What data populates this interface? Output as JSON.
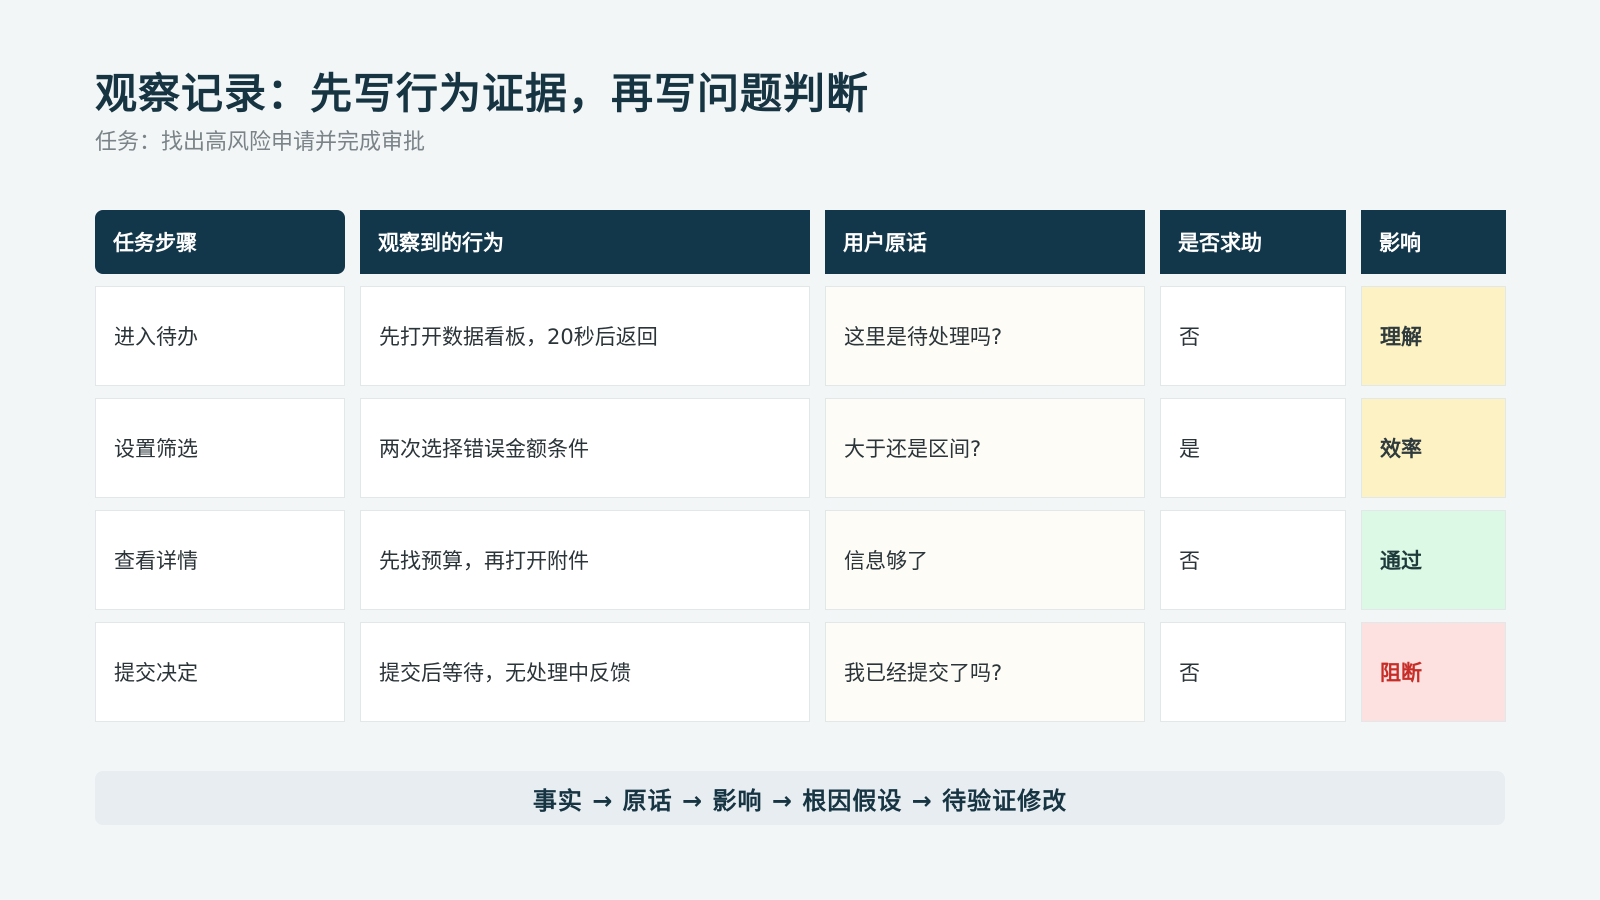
{
  "title": "观察记录：先写行为证据，再写问题判断",
  "subtitle": "任务：找出高风险申请并完成审批",
  "table": {
    "headers": [
      "任务步骤",
      "观察到的行为",
      "用户原话",
      "是否求助",
      "影响"
    ],
    "rows": [
      {
        "step": "进入待办",
        "behavior": "先打开数据看板，20秒后返回",
        "quote": "这里是待处理吗?",
        "help": "否",
        "impact": "理解"
      },
      {
        "step": "设置筛选",
        "behavior": "两次选择错误金额条件",
        "quote": "大于还是区间?",
        "help": "是",
        "impact": "效率"
      },
      {
        "step": "查看详情",
        "behavior": "先找预算，再打开附件",
        "quote": "信息够了",
        "help": "否",
        "impact": "通过"
      },
      {
        "step": "提交决定",
        "behavior": "提交后等待，无处理中反馈",
        "quote": "我已经提交了吗?",
        "help": "否",
        "impact": "阻断"
      }
    ]
  },
  "footer": "事实 → 原话 → 影响 → 根因假设 → 待验证修改",
  "colors": {
    "header_bg": "#12364a",
    "impact_warning_bg": "#fdf2c4",
    "impact_pass_bg": "#dcf9e5",
    "impact_block_bg": "#fde0e0",
    "impact_block_text": "#c72d27"
  }
}
